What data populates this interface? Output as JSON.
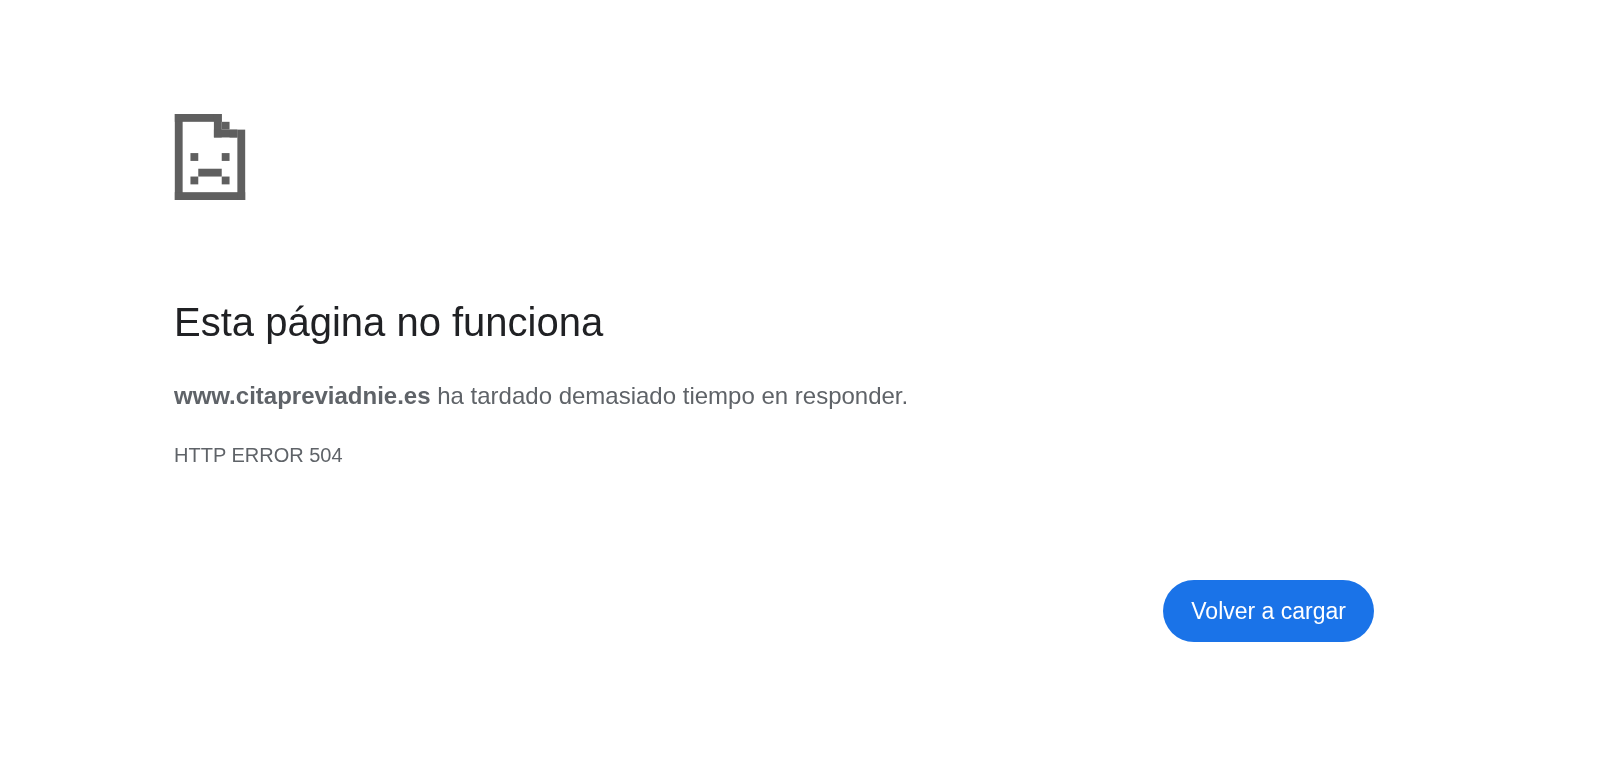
{
  "heading": "Esta página no funciona",
  "message": "**www.citapreviadnie.es** ha tardado demasiado tiempo en responder.",
  "error_code": "HTTP ERROR 504",
  "buttons": [
    {
      "label": "Volver a cargar",
      "primary": true
    }
  ]
}
